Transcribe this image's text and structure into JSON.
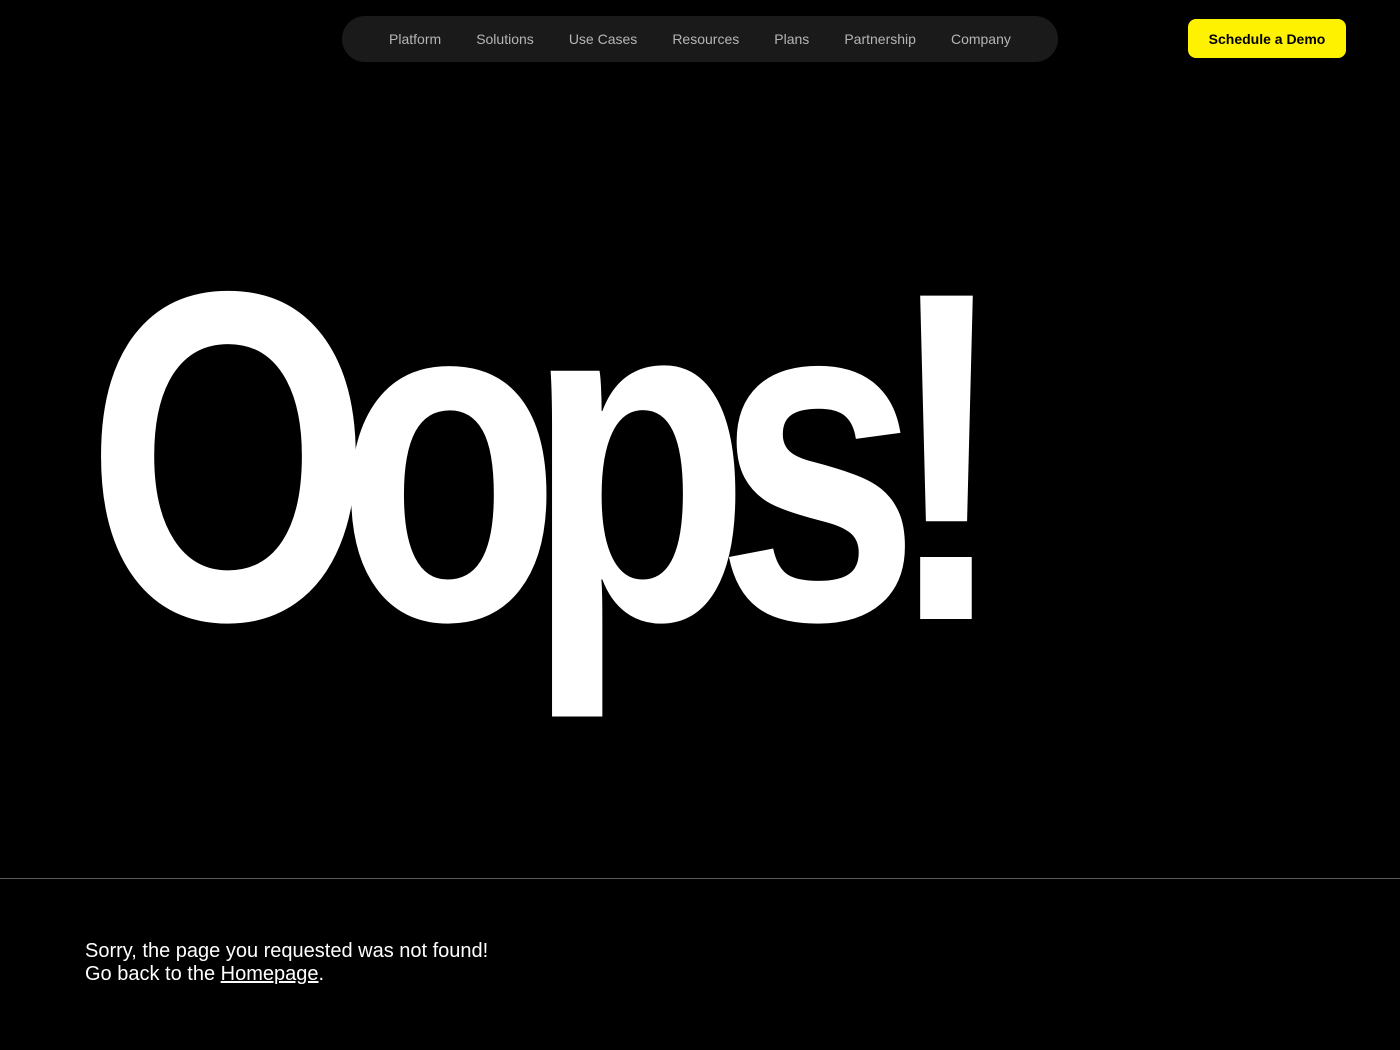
{
  "nav": {
    "items": [
      {
        "label": "Platform"
      },
      {
        "label": "Solutions"
      },
      {
        "label": "Use Cases"
      },
      {
        "label": "Resources"
      },
      {
        "label": "Plans"
      },
      {
        "label": "Partnership"
      },
      {
        "label": "Company"
      }
    ]
  },
  "header": {
    "cta_label": "Schedule a Demo"
  },
  "hero": {
    "title": "Oops!"
  },
  "message": {
    "line1": "Sorry, the page you requested was not found!",
    "line2_prefix": "Go back to the ",
    "link_label": "Homepage",
    "line2_suffix": "."
  },
  "colors": {
    "background": "#000000",
    "accent": "#fff200",
    "nav_background": "#1a1a1a",
    "text": "#ffffff"
  }
}
